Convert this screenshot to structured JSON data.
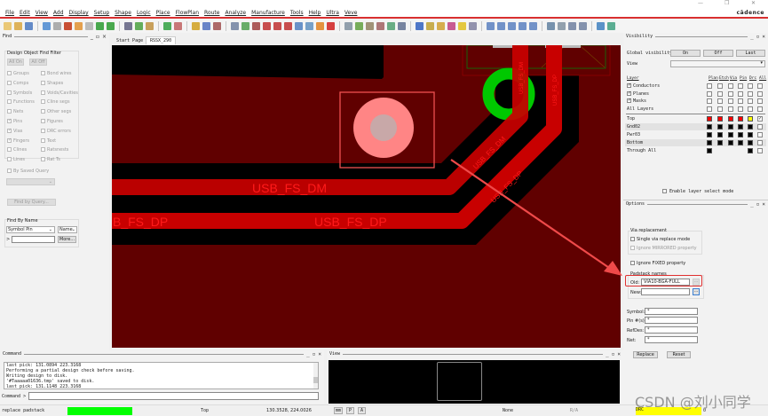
{
  "window": {
    "brand": "cādence",
    "controls": [
      "—",
      "❐",
      "✕"
    ]
  },
  "menu": [
    "File",
    "Edit",
    "View",
    "Add",
    "Display",
    "Setup",
    "Shape",
    "Logic",
    "Place",
    "FlowPlan",
    "Route",
    "Analyze",
    "Manufacture",
    "Tools",
    "Help",
    "Ultra",
    "Veve"
  ],
  "toolbar": [
    {
      "name": "new-icon",
      "color": "#e8c060"
    },
    {
      "name": "open-icon",
      "color": "#d9a640"
    },
    {
      "name": "save-icon",
      "color": "#4a78c0"
    },
    {
      "sep": true
    },
    {
      "name": "move-icon",
      "color": "#4a88d0"
    },
    {
      "name": "copy-icon",
      "color": "#a0a0a0"
    },
    {
      "name": "delete-icon",
      "color": "#c03010"
    },
    {
      "name": "undo-icon",
      "color": "#e09030"
    },
    {
      "name": "redo-icon",
      "color": "#b0b0b0"
    },
    {
      "name": "pin-icon",
      "color": "#2a9a30"
    },
    {
      "name": "fix-icon",
      "color": "#2a9a30"
    },
    {
      "sep": true
    },
    {
      "name": "add-line-icon",
      "color": "#606080"
    },
    {
      "name": "add-text-icon",
      "color": "#4aa040"
    },
    {
      "name": "edit-text-icon",
      "color": "#c09040"
    },
    {
      "sep": true
    },
    {
      "name": "place-icon",
      "color": "#30a040"
    },
    {
      "name": "placement-icon",
      "color": "#c06060"
    },
    {
      "sep": true
    },
    {
      "name": "route-icon",
      "color": "#d0a020"
    },
    {
      "name": "slide-icon",
      "color": "#5070c0"
    },
    {
      "name": "delay-tune-icon",
      "color": "#a05050"
    },
    {
      "sep": true
    },
    {
      "name": "zoom-fit-icon",
      "color": "#7080a0"
    },
    {
      "name": "zoom-world-icon",
      "color": "#50a050"
    },
    {
      "name": "zoom-points-icon",
      "color": "#a04040"
    },
    {
      "name": "zoom-in-icon",
      "color": "#c03030"
    },
    {
      "name": "zoom-out-icon",
      "color": "#c03030"
    },
    {
      "name": "zoom-prev-icon",
      "color": "#c03030"
    },
    {
      "name": "zoom-selection-icon",
      "color": "#5080c0"
    },
    {
      "name": "redraw-icon",
      "color": "#6090c0"
    },
    {
      "name": "refresh-icon",
      "color": "#e08020"
    },
    {
      "name": "3d-view-icon",
      "color": "#d02020"
    },
    {
      "sep": true
    },
    {
      "name": "grid-icon",
      "color": "#8090a0"
    },
    {
      "name": "color-icon",
      "color": "#60a040"
    },
    {
      "name": "shadow-icon",
      "color": "#908060"
    },
    {
      "name": "layer-icon",
      "color": "#a06060"
    },
    {
      "name": "stats-icon",
      "color": "#50a070"
    },
    {
      "name": "snapshot-icon",
      "color": "#607090"
    },
    {
      "sep": true
    },
    {
      "name": "info-icon",
      "color": "#3060c0"
    },
    {
      "name": "property-icon",
      "color": "#c0a030"
    },
    {
      "name": "measure-icon",
      "color": "#d0a030"
    },
    {
      "name": "assign-color-icon",
      "color": "#c04080"
    },
    {
      "name": "highlight-icon",
      "color": "#e0c020"
    },
    {
      "name": "dehighlight-icon",
      "color": "#8080a0"
    },
    {
      "sep": true
    },
    {
      "name": "shape-poly-icon",
      "color": "#5a80c0"
    },
    {
      "name": "shape-rect-icon",
      "color": "#5a80c0"
    },
    {
      "name": "shape-circle-icon",
      "color": "#5a80c0"
    },
    {
      "name": "shape-select-icon",
      "color": "#5a80c0"
    },
    {
      "name": "shape-edit-icon",
      "color": "#5a80c0"
    },
    {
      "sep": true
    },
    {
      "name": "manufacture-icon",
      "color": "#6080a0"
    },
    {
      "name": "drill-icon",
      "color": "#8090a0"
    },
    {
      "name": "camera-icon",
      "color": "#7080a0"
    },
    {
      "name": "settings-icon",
      "color": "#7080a0"
    },
    {
      "sep": true
    },
    {
      "name": "windows-icon",
      "color": "#4080c0"
    },
    {
      "name": "design-icon",
      "color": "#40a080"
    }
  ],
  "find": {
    "title": "Find",
    "filter_title": "Design Object Find Filter",
    "all_on": "All On",
    "all_off": "All Off",
    "left": [
      {
        "label": "Groups",
        "checked": false
      },
      {
        "label": "Comps",
        "checked": false
      },
      {
        "label": "Symbols",
        "checked": false
      },
      {
        "label": "Functions",
        "checked": false
      },
      {
        "label": "Nets",
        "checked": false
      },
      {
        "label": "Pins",
        "checked": true
      },
      {
        "label": "Vias",
        "checked": true
      },
      {
        "label": "Fingers",
        "checked": true
      },
      {
        "label": "Clines",
        "checked": false
      },
      {
        "label": "Lines",
        "checked": false
      }
    ],
    "right": [
      {
        "label": "Bond wires",
        "checked": false
      },
      {
        "label": "Shapes",
        "checked": false
      },
      {
        "label": "Voids/Cavities",
        "checked": false
      },
      {
        "label": "Cline segs",
        "checked": false
      },
      {
        "label": "Other segs",
        "checked": false
      },
      {
        "label": "Figures",
        "checked": false
      },
      {
        "label": "DRC errors",
        "checked": false
      },
      {
        "label": "Text",
        "checked": false
      },
      {
        "label": "Ratsnests",
        "checked": false
      },
      {
        "label": "Rat Ts",
        "checked": false
      }
    ],
    "by_saved_query": "By Saved Query",
    "find_by_query": "Find by Query...",
    "find_by_name": "Find By Name",
    "type_select": "Symbol Pin",
    "name_select": "Name",
    "name_prefix": ">",
    "name_value": "",
    "more": "More..."
  },
  "tabs": [
    {
      "label": "Start Page",
      "active": false
    },
    {
      "label": "RSSX_290",
      "active": true
    }
  ],
  "canvas": {
    "nets": [
      "USB_FS_DM",
      "USB_FS_DP",
      "B_FS_DP"
    ],
    "colors": {
      "plane": "#600000",
      "void": "#000000",
      "trace": "#c80000",
      "label": "#ff1a1a",
      "via_ring": "#00c800",
      "selected_pad": "#ff8080",
      "annotation": "#ef4040"
    }
  },
  "visibility": {
    "title": "Visibility",
    "global_label": "Global visibility",
    "on": "On",
    "off": "Off",
    "last": "Last",
    "view_label": "View",
    "view_value": "",
    "columns": [
      "Layer",
      "Plan",
      "Etch",
      "Via",
      "Pin",
      "Drc",
      "All"
    ],
    "groups": [
      {
        "label": "Conductors",
        "checked": true
      },
      {
        "label": "Planes",
        "checked": true
      },
      {
        "label": "Masks",
        "checked": true
      },
      {
        "label": "All Layers",
        "checked": null
      }
    ],
    "layers": [
      {
        "label": "Top",
        "cells": [
          "#ff0000",
          "#ff0000",
          "#ff0000",
          "#ff0000",
          "#ffff00"
        ],
        "all": true
      },
      {
        "label": "Gnd02",
        "cells": [
          "#000000",
          "#000000",
          "#000000",
          "#000000",
          "#000000"
        ],
        "all": false
      },
      {
        "label": "Pwr03",
        "cells": [
          "#000000",
          "#000000",
          "#000000",
          "#000000",
          "#000000"
        ],
        "all": false
      },
      {
        "label": "Bottom",
        "cells": [
          "#000000",
          "#000000",
          "#000000",
          "#000000",
          "#000000"
        ],
        "all": false
      },
      {
        "label": "Through All",
        "cells": [
          "#000000",
          null,
          null,
          null,
          "#000000"
        ],
        "all": false
      }
    ],
    "enable_layer_select": "Enable layer select mode"
  },
  "options": {
    "title": "Options",
    "via_group": "Via replacement",
    "single_via": "Single via replace mode",
    "ignore_mirrored": "Ignore MIRRORED property",
    "ignore_fixed": "Ignore FIXED property",
    "padstack_group": "Padstack names",
    "old_label": "Old:",
    "old_value": "VIA10-BGA-FULL",
    "new_label": "New:",
    "new_value": "",
    "browse": "...",
    "symbol_label": "Symbol:",
    "symbol_value": "*",
    "pin_label": "Pin #(s):",
    "pin_value": "*",
    "refdes_label": "RefDes:",
    "refdes_value": "*",
    "net_label": "Net:",
    "net_value": "*",
    "replace": "Replace",
    "reset": "Reset"
  },
  "command": {
    "title": "Command",
    "log": [
      "last pick:  131.0894 223.3168",
      "Performing a partial design check before saving.",
      "Writing design to disk.",
      "'#Taaaaa01636.tmp' saved to disk.",
      "last pick:  131.1148 223.3168"
    ],
    "prompt": "Command >",
    "value": ""
  },
  "worldview": {
    "title": "View"
  },
  "status": {
    "command": "replace padstack",
    "progress_color": "#00ff00",
    "layer": "Top",
    "coords": "130.3528, 224.0026",
    "units": "mm",
    "p": "P",
    "a": "A",
    "mode": "None",
    "ra": "R/A",
    "drc": "DRC",
    "drc_color": "#ffff00",
    "drc_count": "0"
  },
  "watermark": "CSDN @刘小同学"
}
